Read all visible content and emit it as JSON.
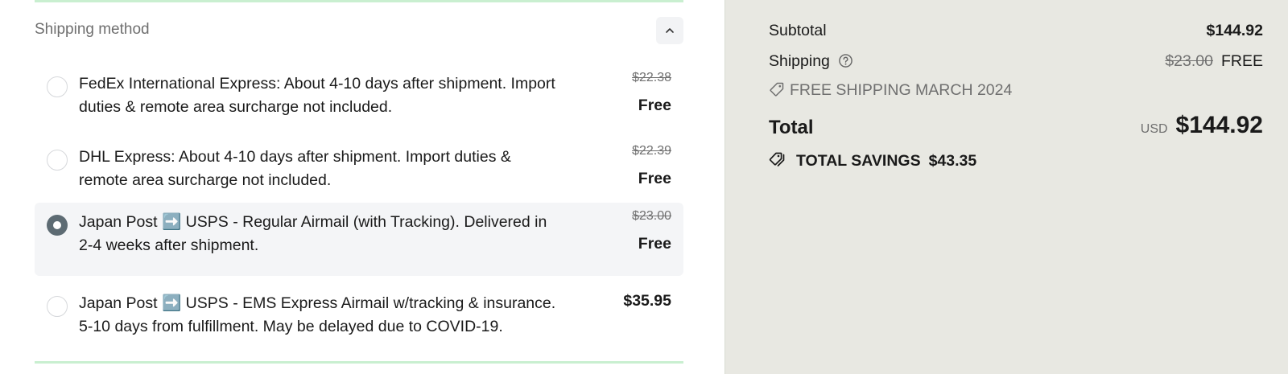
{
  "shipping": {
    "title": "Shipping method",
    "options": [
      {
        "label": "FedEx International Express: About 4-10 days after shipment. Import duties & remote area surcharge not included.",
        "original_price": "$22.38",
        "price": "Free",
        "selected": false
      },
      {
        "label": "DHL Express: About 4-10 days after shipment. Import duties & remote area surcharge not included.",
        "original_price": "$22.39",
        "price": "Free",
        "selected": false
      },
      {
        "label": "Japan Post ➡️ USPS - Regular Airmail (with Tracking). Delivered in 2-4 weeks after shipment.",
        "original_price": "$23.00",
        "price": "Free",
        "selected": true
      },
      {
        "label": "Japan Post ➡️ USPS - EMS Express Airmail w/tracking & insurance. 5-10 days from fulfillment. May be delayed due to COVID-19.",
        "price": "$35.95",
        "selected": false
      }
    ]
  },
  "summary": {
    "subtotal_label": "Subtotal",
    "subtotal_value": "$144.92",
    "shipping_label": "Shipping",
    "shipping_original": "$23.00",
    "shipping_value": "FREE",
    "discount_code": "FREE SHIPPING MARCH 2024",
    "total_label": "Total",
    "currency": "USD",
    "total_value": "$144.92",
    "savings_label": "TOTAL SAVINGS",
    "savings_value": "$43.35"
  },
  "colors": {
    "summary_bg": "#e8e8e2",
    "divider": "#c9efd0",
    "selected_bg": "#f4f5f7",
    "radio_checked": "#5d6b73"
  },
  "icons": {
    "collapse": "chevron-up-icon",
    "help": "question-circle-icon",
    "discount": "tag-icon",
    "savings": "tags-icon"
  }
}
